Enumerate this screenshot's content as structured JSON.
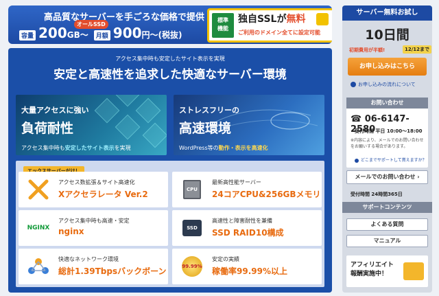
{
  "header": {
    "tagline": "高品質なサーバーを手ごろな価格で提供",
    "ssd_badge": "オールSSD",
    "cap_label": "容量",
    "cap_value": "200",
    "cap_unit": "GB〜",
    "price_label": "月額",
    "price_value": "900",
    "price_unit": "円〜(税抜)"
  },
  "ssl": {
    "std_1": "標準",
    "std_2": "機能",
    "title_pre": "独自SSLが",
    "title_free": "無料",
    "subtitle": "ご利用のドメイン全てに設定可能"
  },
  "main": {
    "subtitle": "アクセス集中時も安定したサイト表示を実現",
    "headline": "安定と高速性を追求した快適なサーバー環境",
    "banner1": {
      "small": "大量アクセスに強い",
      "large": "負荷耐性",
      "cap_pre": "アクセス集中時も",
      "cap_em": "安定したサイト表示",
      "cap_post": "を実現"
    },
    "banner2": {
      "small": "ストレスフリーの",
      "large": "高速環境",
      "cap_pre": "WordPress等の",
      "cap_em": "動作・表示を高速化",
      "cap_post": ""
    },
    "exclusive": "エックスサーバーだけ！",
    "features": [
      {
        "icon": "x-accelerator-icon",
        "sub": "アクセス数拡張＆サイト高速化",
        "main": "Xアクセラレータ Ver.2"
      },
      {
        "icon": "cpu-icon",
        "sub": "最新高性能サーバー",
        "main": "24コアCPU&256GBメモリ"
      },
      {
        "icon": "nginx-logo",
        "sub": "アクセス集中時も高速・安定",
        "main": "nginx"
      },
      {
        "icon": "ssd-icon",
        "sub": "高速性と障害耐性を兼備",
        "main": "SSD RAID10構成"
      },
      {
        "icon": "network-icon",
        "sub": "快適なネットワーク環境",
        "main": "総計1.39Tbpsバックボーン"
      },
      {
        "icon": "uptime-badge-icon",
        "sub": "安定の実績",
        "main": "稼働率99.99%以上"
      }
    ],
    "nginx_logo_text": "NGINX",
    "cpu_text": "CPU",
    "ssd_text": "SSD",
    "uptime_text": "99.99%"
  },
  "sidebar": {
    "trial_head": "サーバー無料お試し",
    "trial_days": "10日間",
    "campaign": "初期費用が半額!",
    "campaign_date": "12/12まで",
    "apply": "お申し込みはこちら",
    "flow": "お申し込みの流れについて",
    "contact_head": "お問い合わせ",
    "phone": "06-6147-2580",
    "hours": "受付時間 平日 10:00〜18:00",
    "note": "※内容により、メールでのお問い合わせをお願いする場合があります。",
    "faq_link": "どこまでサポートして貰えますか？",
    "mail": "メールでのお問い合わせ",
    "mail_hours": "受付時間 24時間365日",
    "support_head": "サポートコンテンツ",
    "faq": "よくある質問",
    "manual": "マニュアル",
    "affiliate_1": "アフィリエイト",
    "affiliate_2": "報酬実施中！"
  }
}
